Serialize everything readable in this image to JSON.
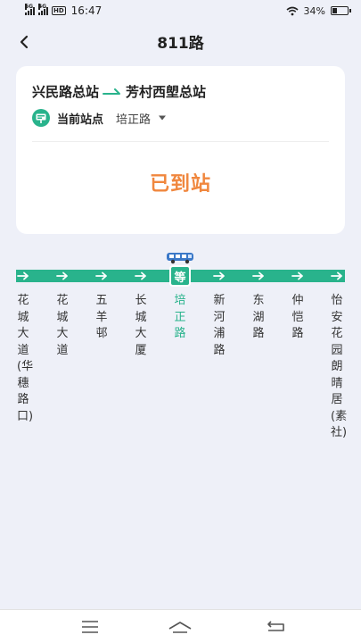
{
  "status_bar": {
    "signal1_label": "5G",
    "signal2_label": "4G",
    "hd_label": "HD",
    "time": "16:47",
    "battery_text": "34%",
    "battery_level": 0.34
  },
  "header": {
    "title": "811路"
  },
  "route": {
    "from": "兴民路总站",
    "to": "芳村西塱总站",
    "current_label": "当前站点",
    "current_stop": "培正路",
    "status": "已到站"
  },
  "map": {
    "wait_label": "等",
    "stations": [
      "花城大道(华穗路口)",
      "花城大道",
      "五羊邨",
      "长城大厦",
      "培正路",
      "新河浦路",
      "东湖路",
      "仲恺路",
      "怡安花园朗晴居(素社)"
    ],
    "current_index": 4
  },
  "colors": {
    "accent": "#29b38c",
    "arrived": "#f0873e",
    "background": "#eef0f8"
  },
  "icons": {
    "back": "chevron-left-icon",
    "stop": "bus-stop-sign-icon",
    "bus": "bus-icon",
    "menu": "menu-icon",
    "home": "home-icon",
    "return": "return-icon"
  }
}
